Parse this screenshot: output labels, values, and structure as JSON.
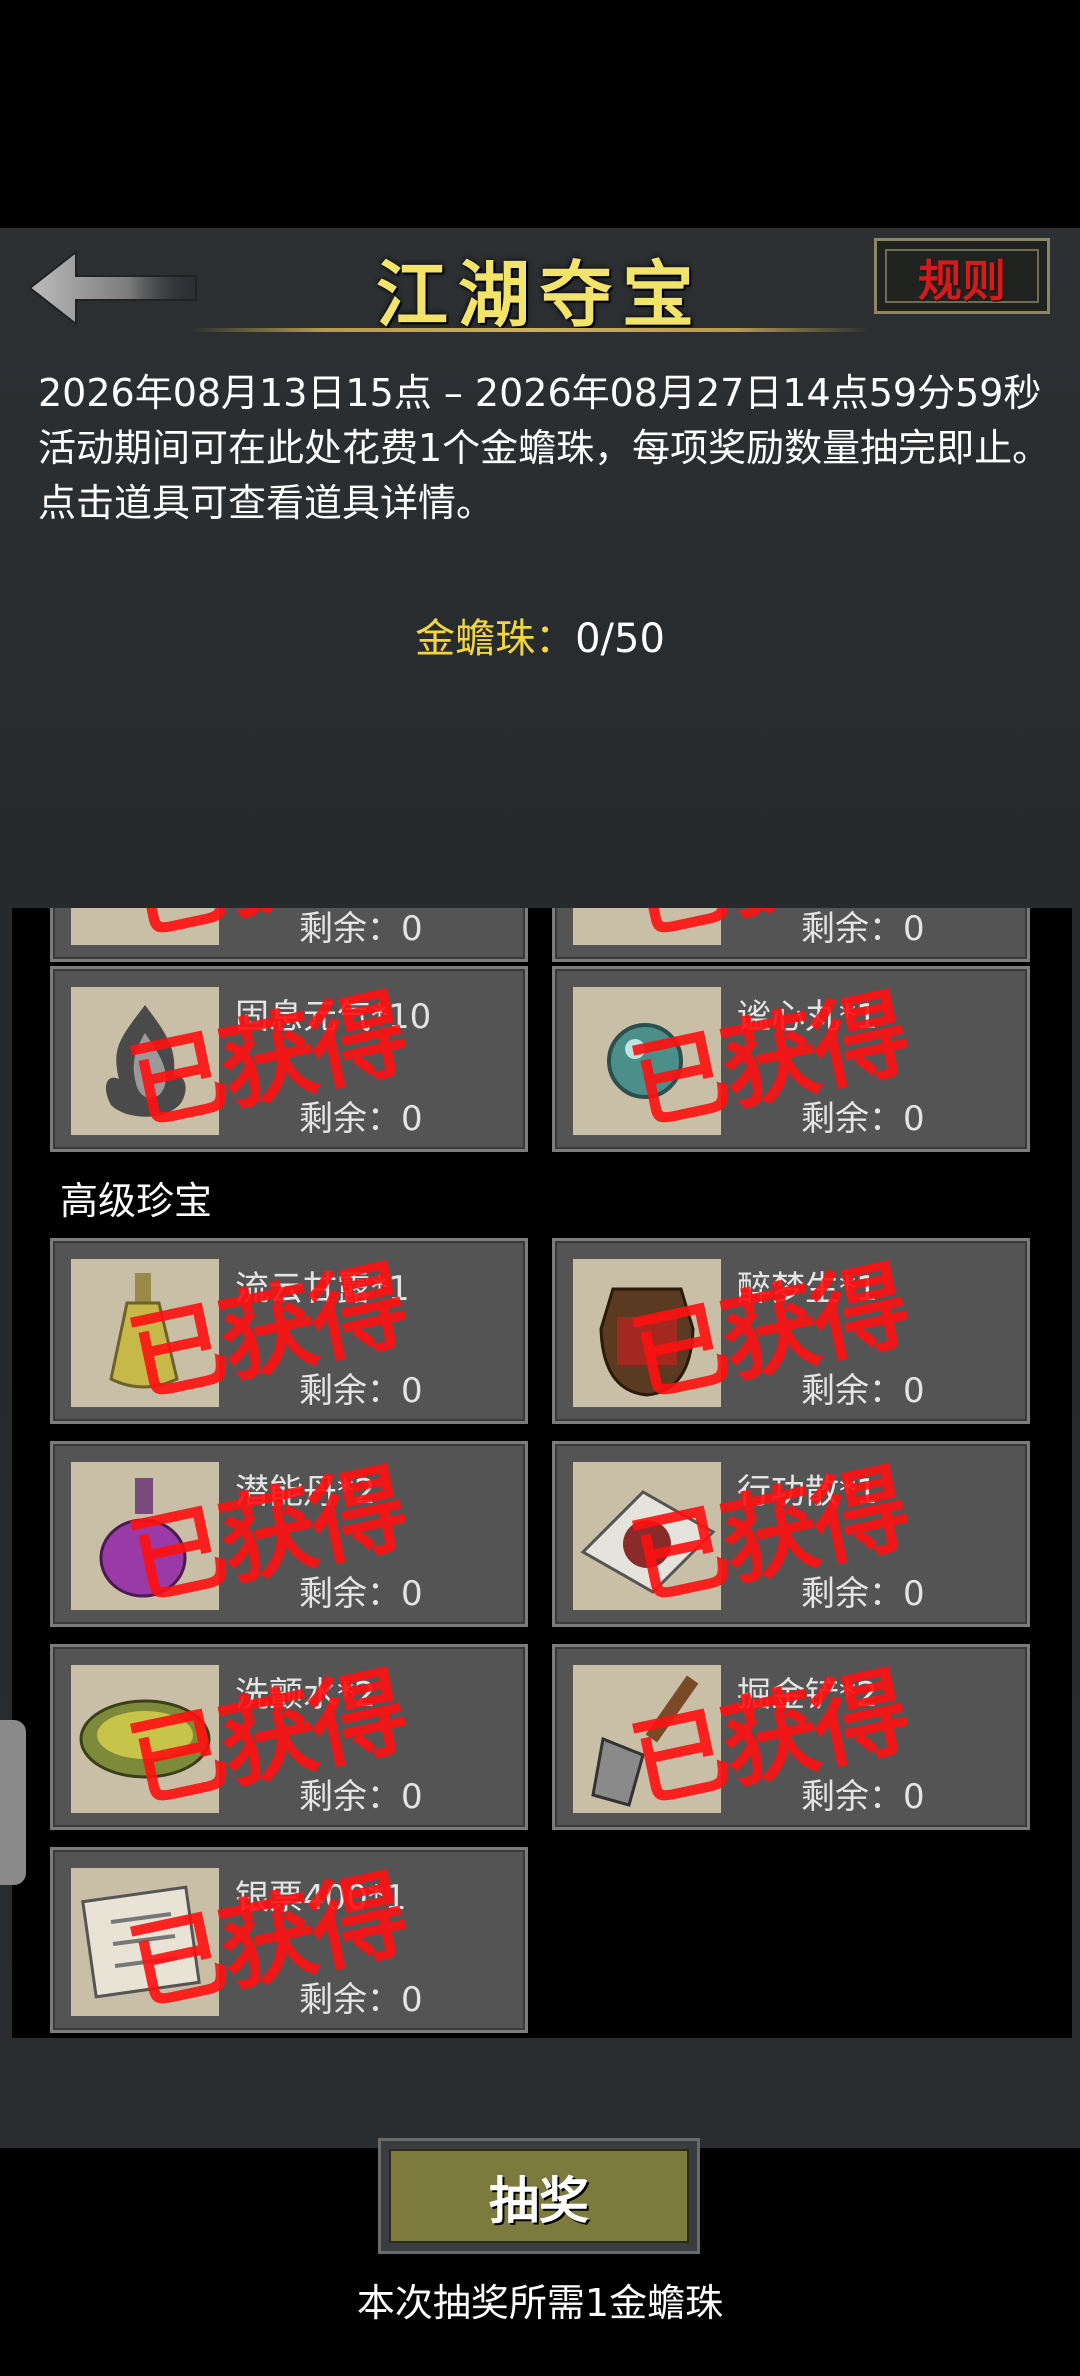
{
  "header": {
    "title": "江湖夺宝",
    "rules_label": "规则"
  },
  "info": {
    "period": "2026年08月13日15点 – 2026年08月27日14点59分59秒",
    "rule_line": "活动期间可在此处花费1个金蟾珠，每项奖励数量抽完即止。",
    "hint": "点击道具可查看道具详情。"
  },
  "coin": {
    "label": "金蟾珠：",
    "value": "0/50"
  },
  "stamp_text": "已获得",
  "partial_row": [
    {
      "remain": "剩余：0"
    },
    {
      "remain": "剩余：0"
    }
  ],
  "section_top": [
    {
      "name": "固息元气*10",
      "remain": "剩余：0",
      "icon": "flame-icon"
    },
    {
      "name": "谧心丸*1",
      "remain": "剩余：0",
      "icon": "pearl-icon"
    }
  ],
  "section_label": "高级珍宝",
  "advanced_items": [
    {
      "name": "流云甘露*1",
      "remain": "剩余：0",
      "icon": "flask-icon"
    },
    {
      "name": "醉梦生*1",
      "remain": "剩余：0",
      "icon": "wine-jar-icon"
    },
    {
      "name": "潜能丹*2",
      "remain": "剩余：0",
      "icon": "potion-bottle-icon"
    },
    {
      "name": "行功散*1",
      "remain": "剩余：0",
      "icon": "powder-packet-icon"
    },
    {
      "name": "洗颤水*2",
      "remain": "剩余：0",
      "icon": "bowl-icon"
    },
    {
      "name": "掘金铲*2",
      "remain": "剩余：0",
      "icon": "shovel-icon"
    },
    {
      "name": "银票400*1",
      "remain": "剩余：0",
      "icon": "banknote-icon"
    }
  ],
  "draw": {
    "label": "抽奖",
    "cost_note": "本次抽奖所需1金蟾珠"
  }
}
